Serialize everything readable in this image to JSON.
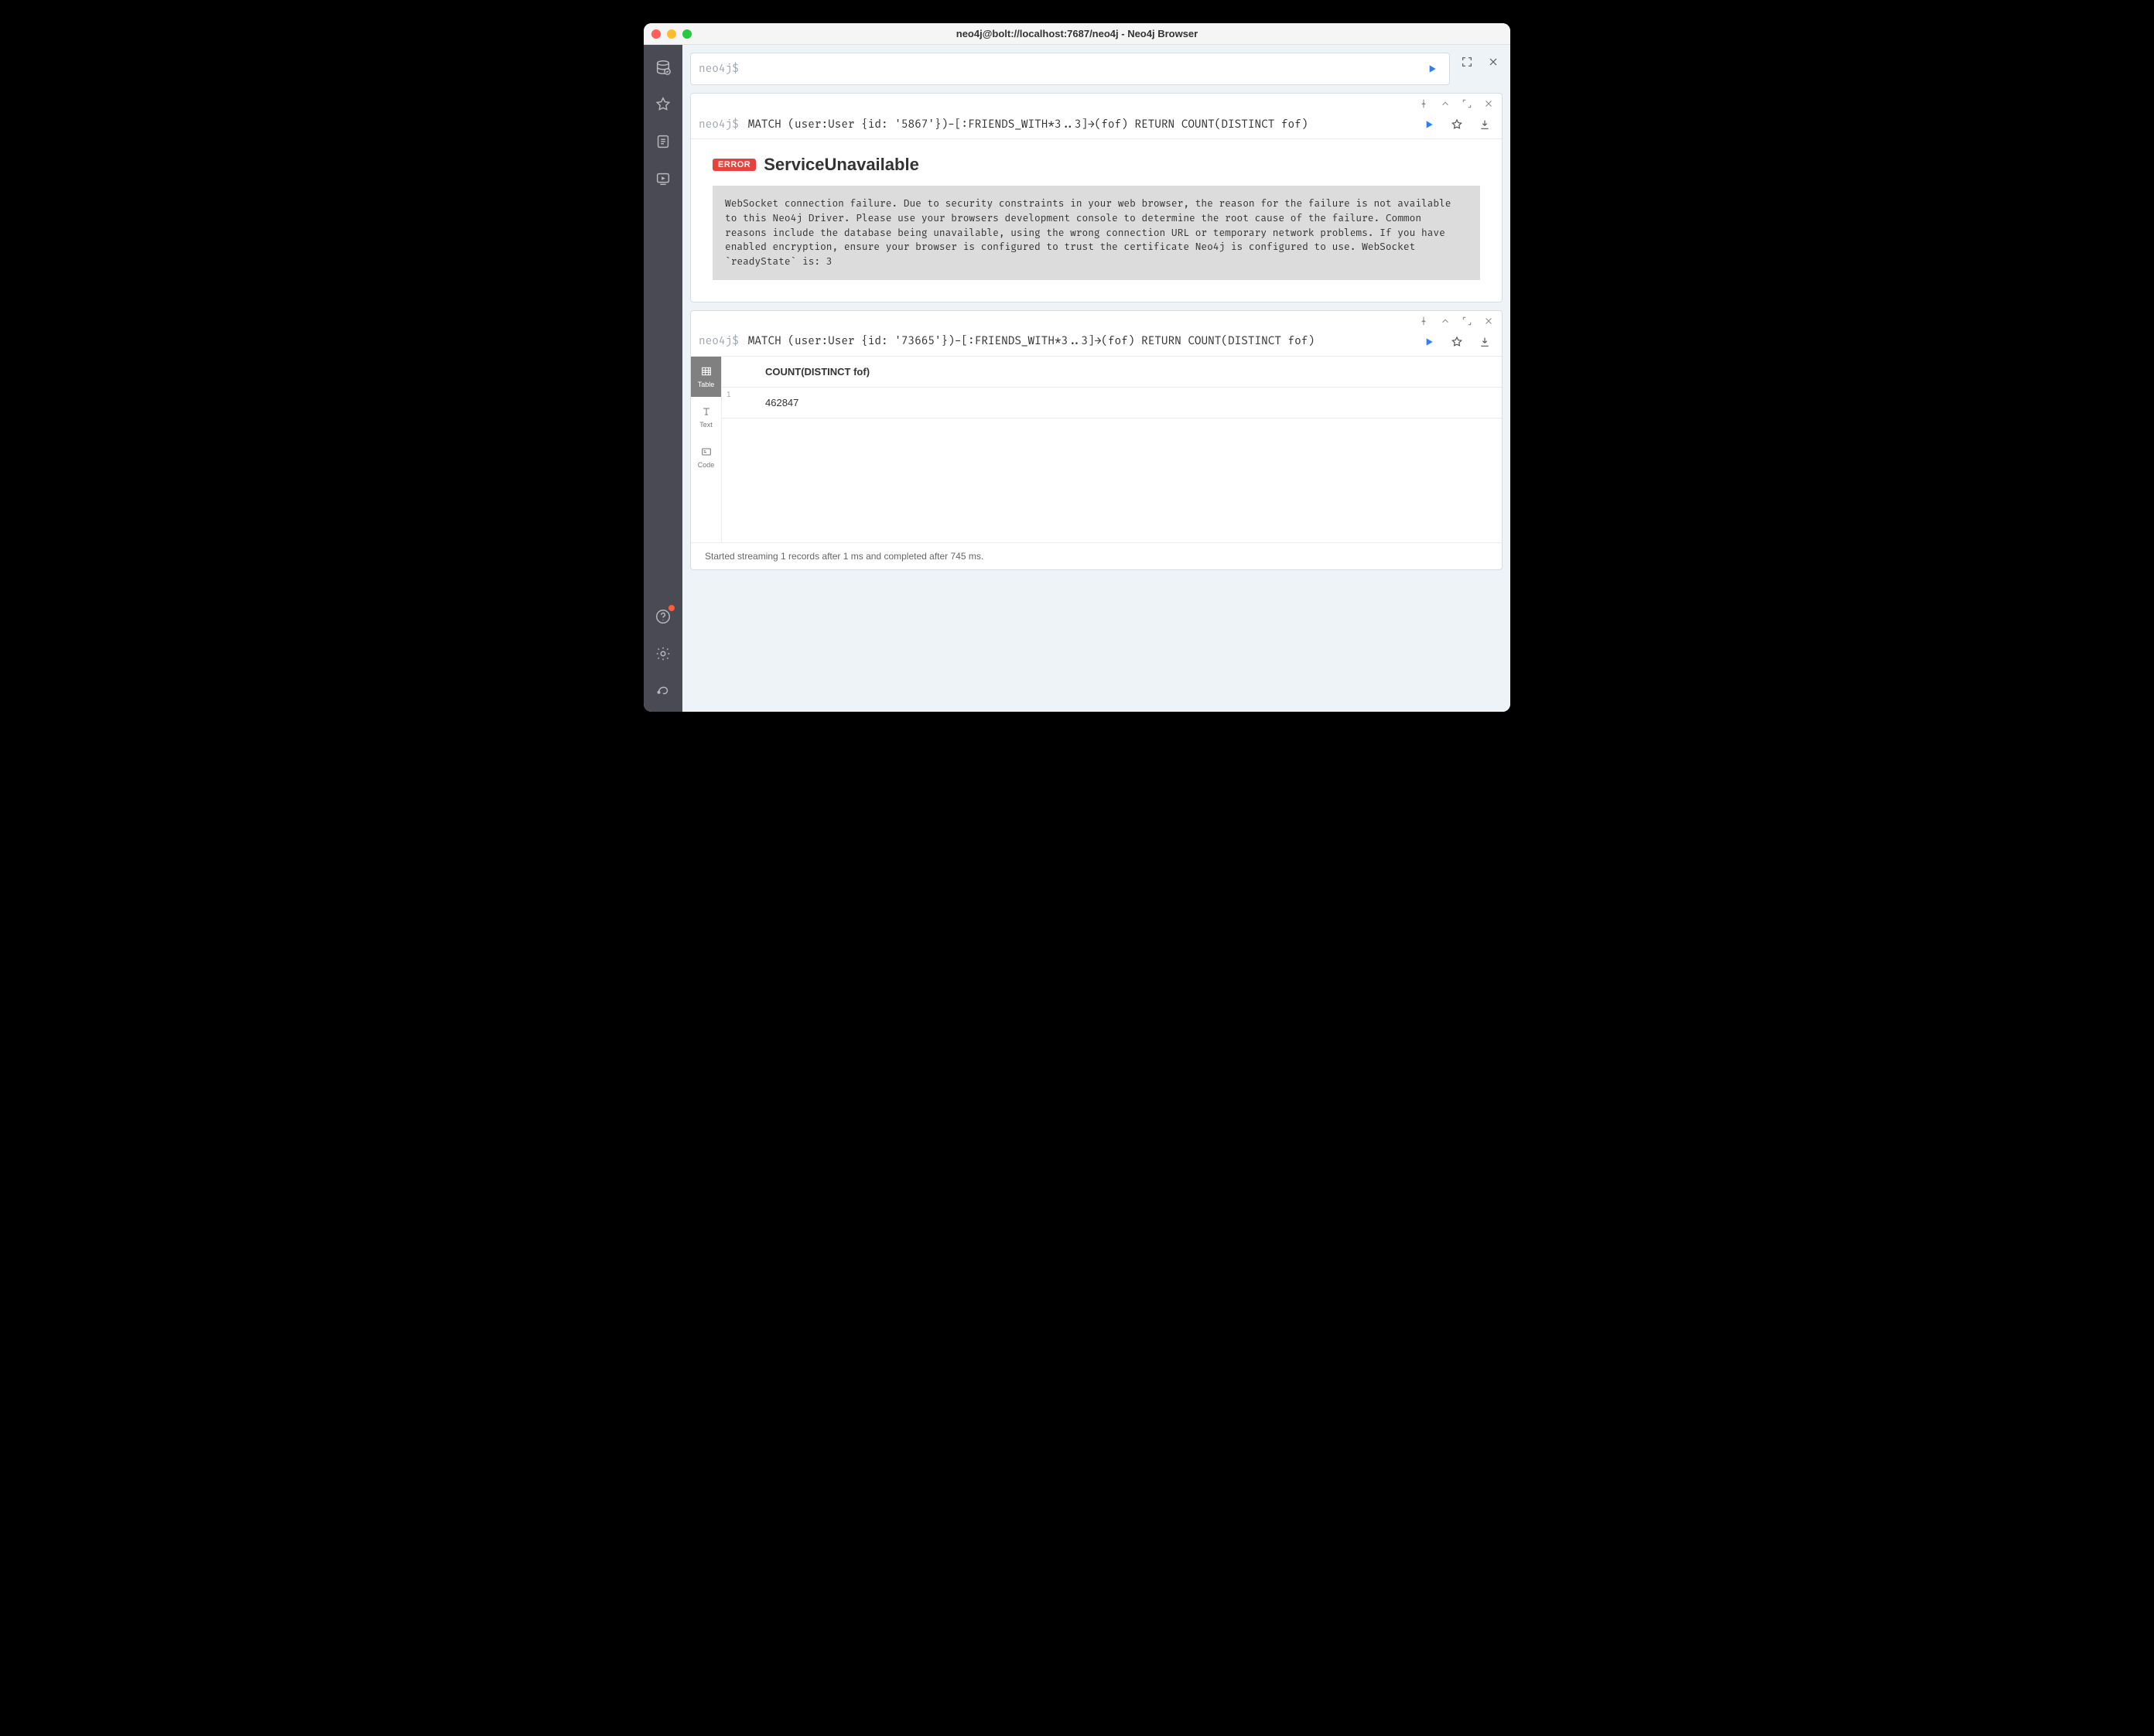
{
  "titlebar": {
    "title": "neo4j@bolt://localhost:7687/neo4j - Neo4j Browser"
  },
  "editor": {
    "prompt": "neo4j$",
    "value": ""
  },
  "frames": [
    {
      "prompt": "neo4j$",
      "query": "MATCH (user:User {id: '5867'})-[:FRIENDS_WITH*3..3]→(fof) RETURN COUNT(DISTINCT fof)",
      "error": {
        "badge": "ERROR",
        "title": "ServiceUnavailable",
        "message": "WebSocket connection failure. Due to security constraints in your web browser, the reason for the failure is not available to this Neo4j Driver. Please use your browsers development console to determine the root cause of the failure. Common reasons include the database being unavailable, using the wrong connection URL or temporary network problems. If you have enabled encryption, ensure your browser is configured to trust the certificate Neo4j is configured to use. WebSocket `readyState` is: 3"
      }
    },
    {
      "prompt": "neo4j$",
      "query": "MATCH (user:User {id: '73665'})-[:FRIENDS_WITH*3..3]→(fof) RETURN COUNT(DISTINCT fof)",
      "view_tabs": [
        {
          "id": "table",
          "label": "Table",
          "active": true
        },
        {
          "id": "text",
          "label": "Text",
          "active": false
        },
        {
          "id": "code",
          "label": "Code",
          "active": false
        }
      ],
      "table": {
        "header": "COUNT(DISTINCT fof)",
        "rows": [
          {
            "n": "1",
            "value": "462847"
          }
        ]
      },
      "status": "Started streaming 1 records after 1 ms and completed after 745 ms."
    }
  ]
}
